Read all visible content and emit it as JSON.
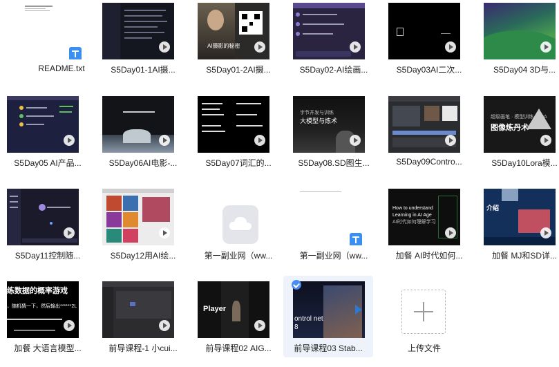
{
  "files": [
    {
      "name": "README.txt"
    },
    {
      "name": "S5Day01-1AI摄..."
    },
    {
      "name": "S5Day01-2AI摄..."
    },
    {
      "name": "S5Day02-AI绘画..."
    },
    {
      "name": "S5Day03AI二次..."
    },
    {
      "name": "S5Day04 3D与..."
    },
    {
      "name": "S5Day05 AI产品..."
    },
    {
      "name": "S5Day06AI电影-..."
    },
    {
      "name": "S5Day07词汇的..."
    },
    {
      "name": "S5Day08.SD图生..."
    },
    {
      "name": "S5Day09Contro..."
    },
    {
      "name": "S5Day10Lora模..."
    },
    {
      "name": "S5Day11控制随..."
    },
    {
      "name": "S5Day12用AI绘..."
    },
    {
      "name": "第一副业网（ww..."
    },
    {
      "name": "第一副业网（ww..."
    },
    {
      "name": "加餐 AI时代如何..."
    },
    {
      "name": "加餐 MJ和SD详..."
    },
    {
      "name": "加餐 大语言模型..."
    },
    {
      "name": "前导课程-1 小cui..."
    },
    {
      "name": "前导课程02 AIG..."
    },
    {
      "name": "前导课程03 Stab..."
    },
    {
      "name": "上传文件"
    }
  ],
  "thumb_text": {
    "day08_title": "大模型与炼术",
    "day08_sub": "字节开发与训练",
    "day10_title": "图像炼丹术",
    "day10_sub": "超级画笔 · 模型训练 LoRA",
    "ai_learn_1": "How to understand",
    "ai_learn_2": "Learning in AI Age",
    "ai_learn_3": "AI时代如何理解学习",
    "mj_sd": "介绍",
    "llm_1": "练数据的概率游戏",
    "llm_2": "，随机猜一下，然后输出******2L",
    "pre02": "Player",
    "pre03_1": "ontrol net",
    "pre03_2": "8",
    "day01_2": "AI摄影的秘密"
  },
  "selected_file": "前导课程03 Stab...",
  "colors": {
    "accent": "#3b8ff0",
    "selected_bg": "#eef3fb"
  }
}
